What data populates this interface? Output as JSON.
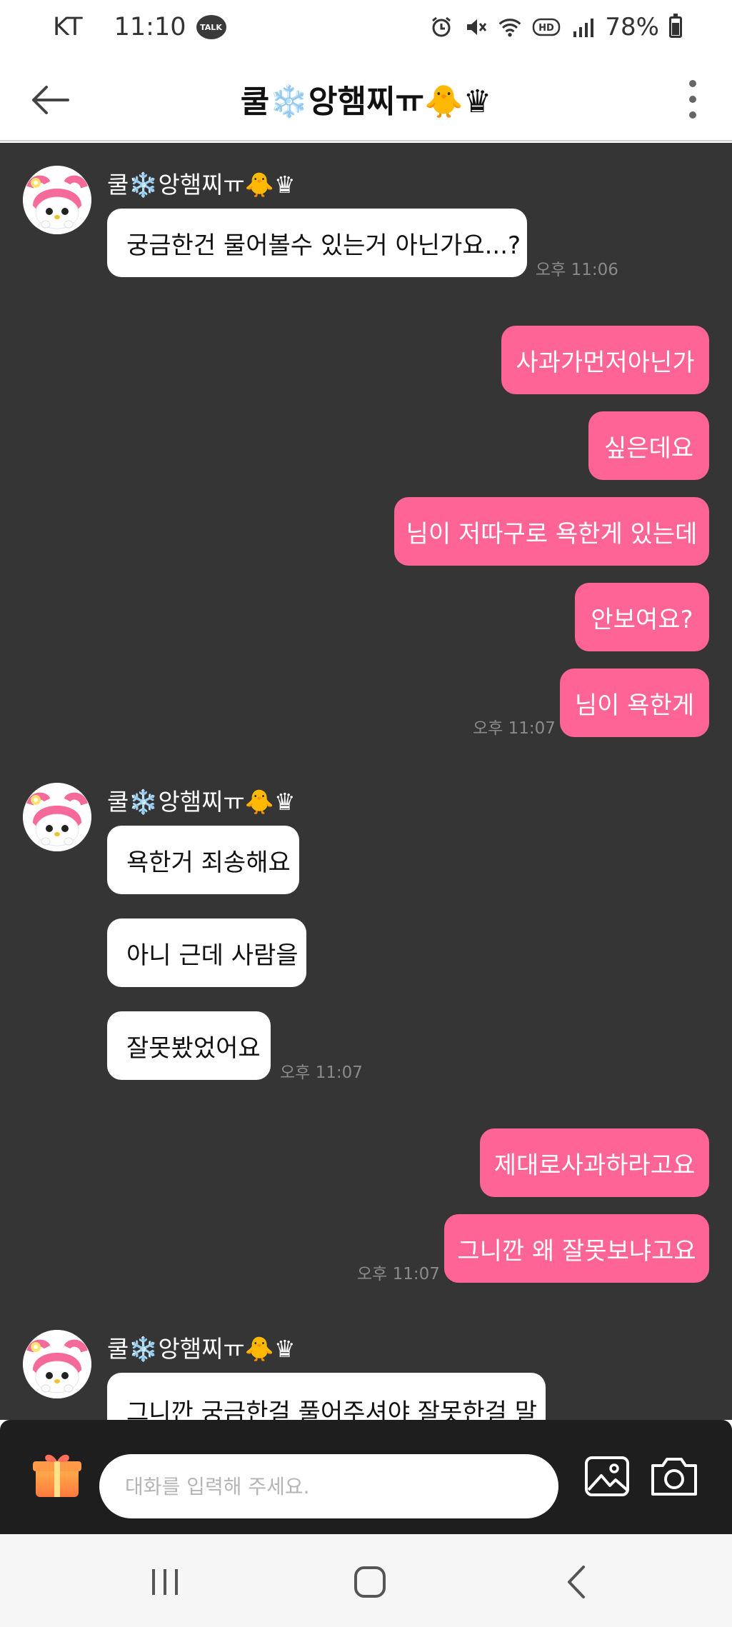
{
  "status_bar": {
    "carrier": "KT",
    "time": "11:10",
    "talk_badge": "TALK",
    "hd_label": "HD",
    "battery": "78%",
    "icons": [
      "alarm-icon",
      "mute-icon",
      "wifi-icon",
      "hd-icon",
      "signal-icon",
      "battery-icon"
    ]
  },
  "header": {
    "title": "쿨❄️앙햄찌ㅠ🐥♛"
  },
  "chat": {
    "groups": [
      {
        "sender": "쿨❄️앙햄찌ㅠ🐥♛",
        "messages": [
          {
            "text": "궁금한건 물어볼수 있는거 아닌가요...?"
          }
        ],
        "time": "오후 11:06"
      },
      {
        "messages": [
          {
            "text": "사과가먼저아닌가"
          },
          {
            "text": "싶은데요"
          },
          {
            "text": "님이 저따구로 욕한게 있는데"
          },
          {
            "text": "안보여요?"
          },
          {
            "text": "님이 욕한게"
          }
        ],
        "time": "오후 11:07"
      },
      {
        "sender": "쿨❄️앙햄찌ㅠ🐥♛",
        "messages": [
          {
            "text": "욕한거 죄송해요"
          },
          {
            "text": "아니 근데 사람을"
          },
          {
            "text": "잘못봤었어요"
          }
        ],
        "time": "오후 11:07"
      },
      {
        "messages": [
          {
            "text": "제대로사과하라고요"
          },
          {
            "text": "그니깐 왜 잘못보냐고요"
          }
        ],
        "time": "오후 11:07"
      },
      {
        "sender": "쿨❄️앙햄찌ㅠ🐥♛",
        "messages": [
          {
            "text": "그니깐 궁금한걸 풀어주셔야 잘못한걸 말"
          }
        ]
      }
    ]
  },
  "input": {
    "placeholder": "대화를 입력해 주세요."
  },
  "colors": {
    "chat_background": "#353535",
    "outgoing_bubble": "#fe6496",
    "incoming_bubble": "#ffffff",
    "input_bar": "#1e1e1e"
  }
}
